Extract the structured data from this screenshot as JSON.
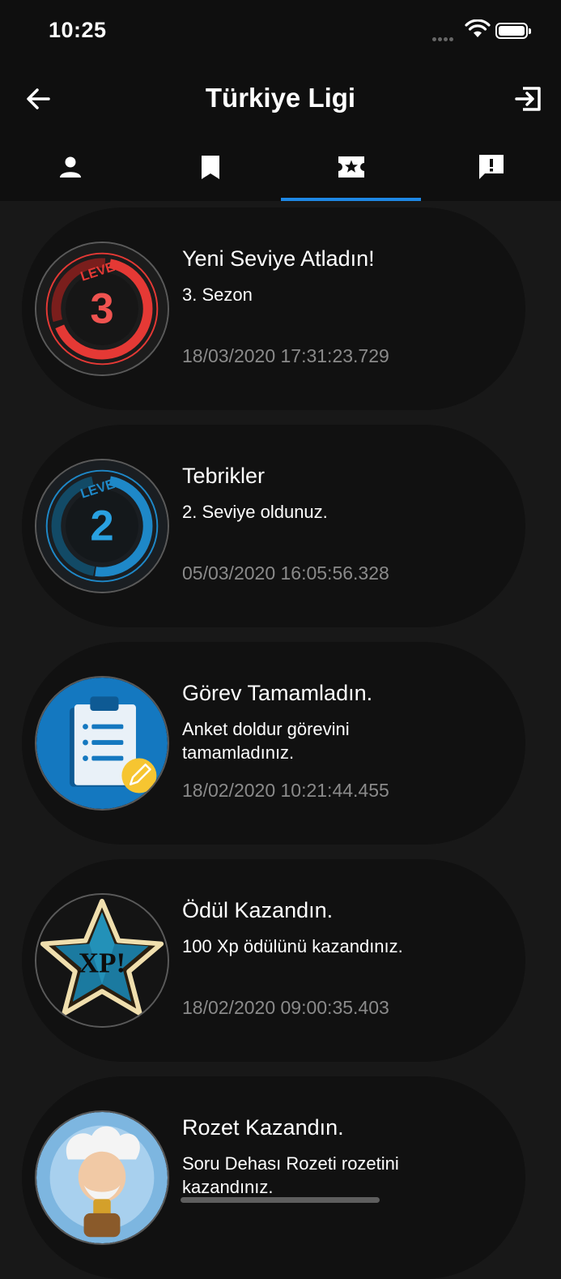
{
  "status_bar": {
    "time": "10:25"
  },
  "header": {
    "title": "Türkiye Ligi"
  },
  "tabs": [
    {
      "icon": "person-icon"
    },
    {
      "icon": "bookmark-icon"
    },
    {
      "icon": "star-ticket-icon",
      "active": true
    },
    {
      "icon": "feedback-icon"
    }
  ],
  "notifications": [
    {
      "title": "Yeni Seviye Atladın!",
      "body": "3. Sezon",
      "date": "18/03/2020 17:31:23.729",
      "badge": "level-3-badge",
      "badge_text": "LEVEL",
      "badge_number": "3"
    },
    {
      "title": "Tebrikler",
      "body": "2. Seviye oldunuz.",
      "date": "05/03/2020 16:05:56.328",
      "badge": "level-2-badge",
      "badge_text": "LEVEL",
      "badge_number": "2"
    },
    {
      "title": "Görev Tamamladın.",
      "body": "Anket doldur görevini tamamladınız.",
      "date": "18/02/2020 10:21:44.455",
      "badge": "clipboard-badge"
    },
    {
      "title": "Ödül Kazandın.",
      "body": "100 Xp ödülünü kazandınız.",
      "date": "18/02/2020 09:00:35.403",
      "badge": "xp-star-badge",
      "badge_text": "XP!"
    },
    {
      "title": "Rozet Kazandın.",
      "body": "Soru Dehası Rozeti rozetini kazandınız.",
      "date": "",
      "badge": "genius-badge"
    }
  ],
  "colors": {
    "accent": "#1e88e5",
    "level3": "#e53935",
    "level2": "#1e88c8",
    "card_bg": "#111111",
    "page_bg": "#181818"
  }
}
